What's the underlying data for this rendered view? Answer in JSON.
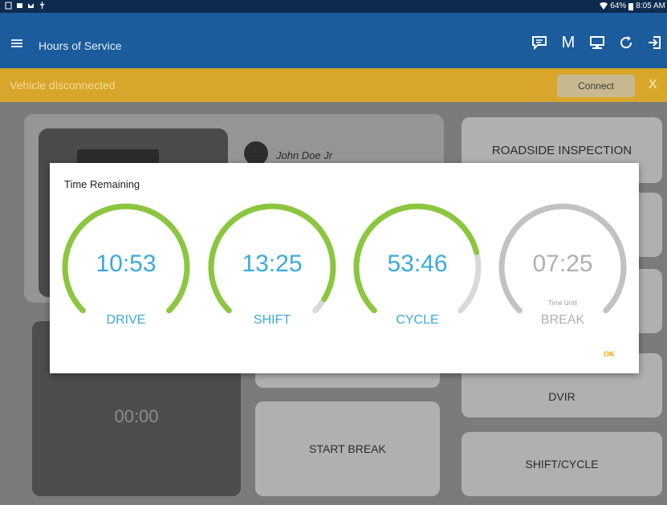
{
  "status_bar": {
    "left_icons": [
      "notification-icon",
      "gallery-icon",
      "gmail-icon",
      "usb-icon"
    ],
    "battery": "64%",
    "time": "8:05 AM"
  },
  "app_bar": {
    "title": "Hours of Service",
    "actions": [
      "chat-icon",
      "m-icon",
      "monitor-icon",
      "refresh-icon",
      "logout-icon"
    ],
    "m_label": "M"
  },
  "banner": {
    "text": "Vehicle disconnected",
    "button": "Connect",
    "close": "X"
  },
  "background": {
    "user_name": "John Doe Jr",
    "timer": "00:00",
    "tiles": {
      "roadside": "ROADSIDE INSPECTION",
      "dvir": "DVIR",
      "start_break": "START BREAK",
      "shift_cycle": "SHIFT/CYCLE"
    }
  },
  "dialog": {
    "title": "Time Remaining",
    "ok": "OK",
    "gauges": [
      {
        "time": "10:53",
        "label": "DRIVE",
        "fraction": 1.0,
        "color": "#8cc63f"
      },
      {
        "time": "13:25",
        "label": "SHIFT",
        "fraction": 0.95,
        "color": "#8cc63f"
      },
      {
        "time": "53:46",
        "label": "CYCLE",
        "fraction": 0.78,
        "color": "#8cc63f"
      },
      {
        "time": "07:25",
        "sub": "Time Until",
        "label": "BREAK",
        "fraction": 1.0,
        "color": "#c2c2c2"
      }
    ],
    "track_color": "#d9d9d9"
  }
}
